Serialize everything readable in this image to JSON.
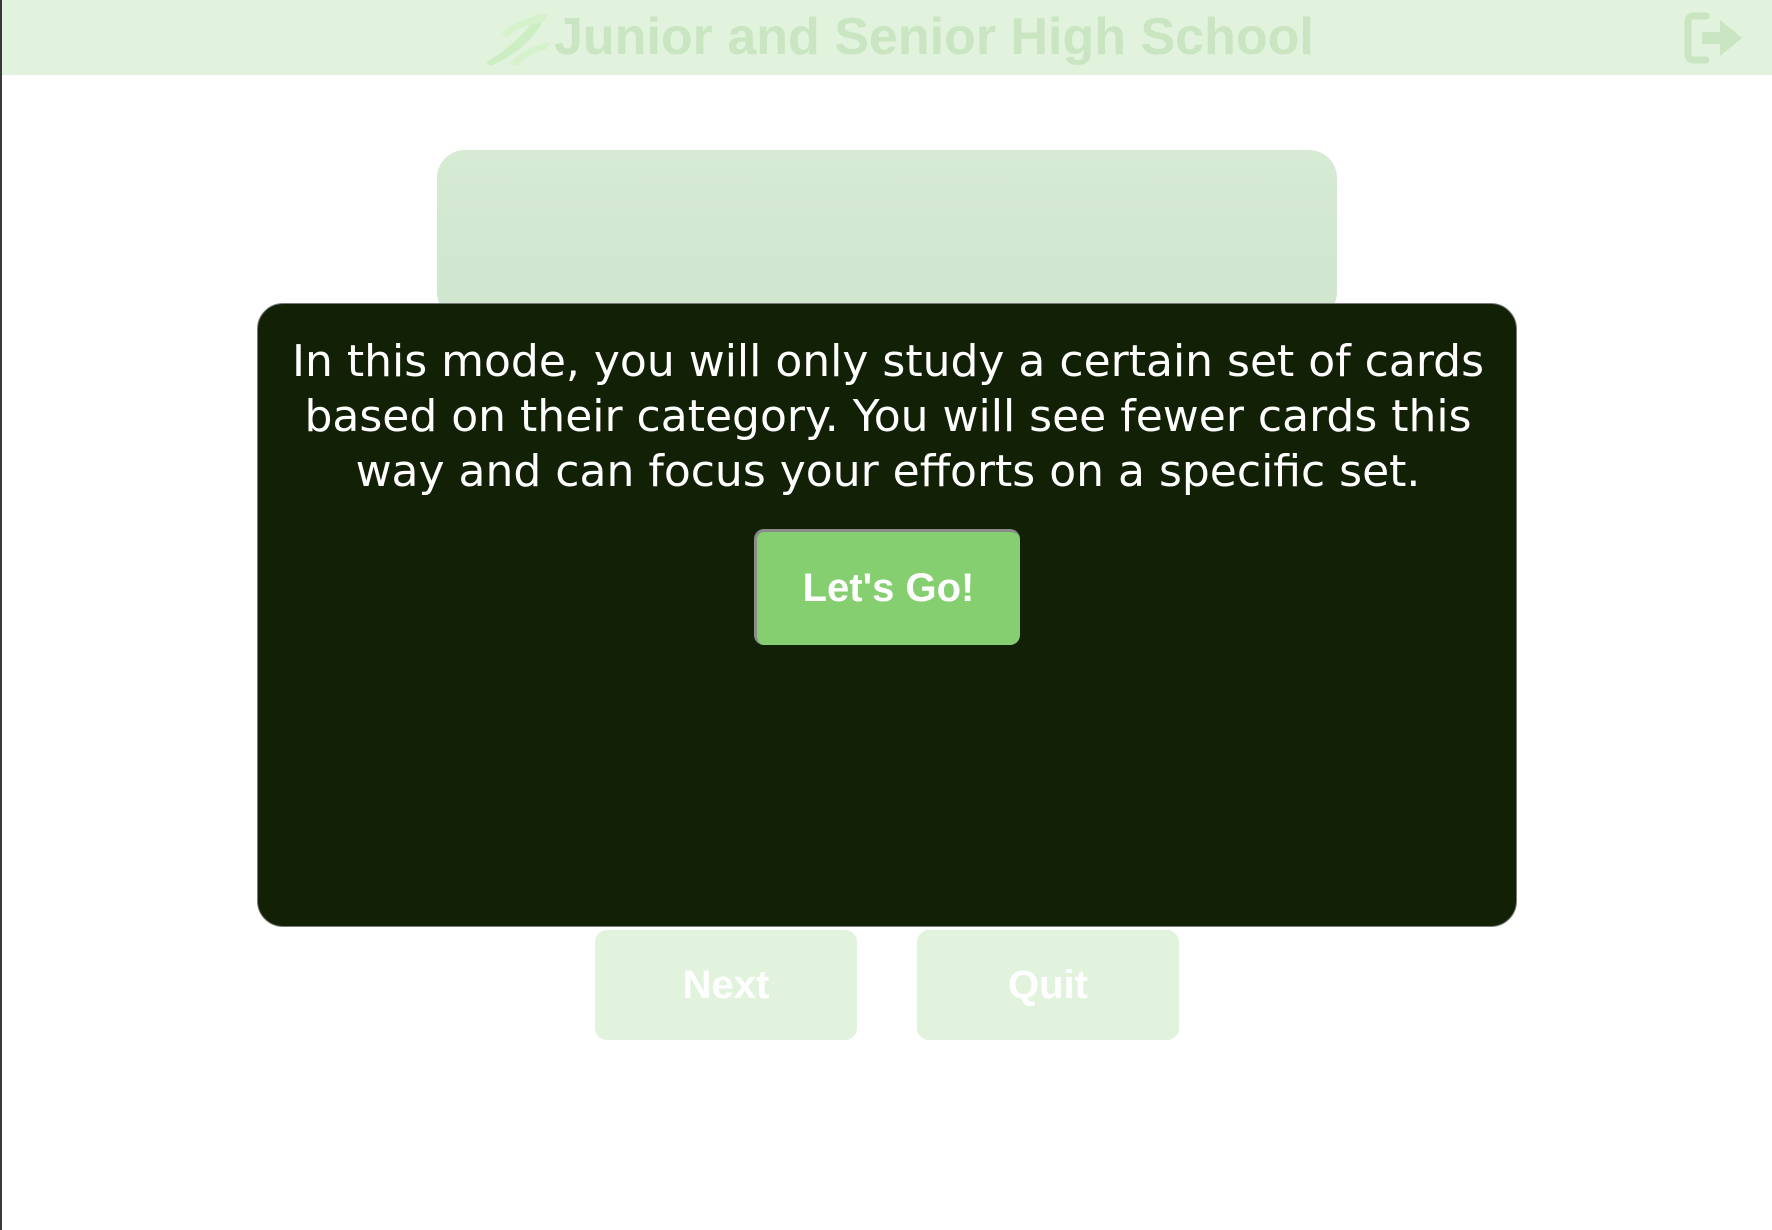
{
  "header": {
    "title": "Junior and Senior High School",
    "logo_icon": "green-wing-logo",
    "logout_icon": "sign-out-icon"
  },
  "modal": {
    "message": "In this mode, you will only study a certain set of cards based on their category. You will see fewer cards this way and can focus your efforts on a specific set.",
    "button_label": "Let's Go!"
  },
  "controls": {
    "next_label": "Next",
    "quit_label": "Quit"
  },
  "colors": {
    "header_bg": "#e1f3dc",
    "header_text": "#c9e5c2",
    "modal_bg": "#122106",
    "button_green": "#85cf70",
    "card_bg": "#d3e8d1"
  }
}
